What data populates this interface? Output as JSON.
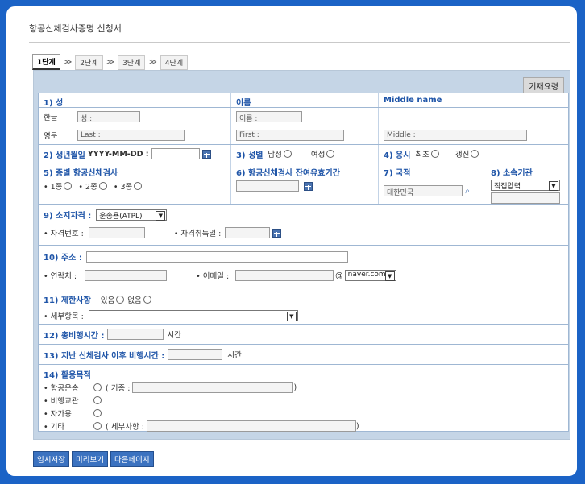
{
  "page": {
    "title": "항공신체검사증명 신청서"
  },
  "steps": [
    "1단계",
    "2단계",
    "3단계",
    "4단계"
  ],
  "step_sep": "≫",
  "remark_button": "기재요령",
  "name": {
    "surname_label": "1) 성",
    "given_label": "이름",
    "middle_label": "Middle name",
    "korean_label": "한글",
    "english_label": "영문",
    "surname_prefix": "성 :",
    "given_prefix": "이름 :",
    "last_prefix": "Last :",
    "first_prefix": "First :",
    "middle_prefix": "Middle :"
  },
  "birth": {
    "label": "2) 생년월일",
    "format": "YYYY-MM-DD :"
  },
  "gender": {
    "label": "3) 성별",
    "male": "남성",
    "female": "여성"
  },
  "apply": {
    "label": "4) 응시",
    "first": "최초",
    "renew": "갱신"
  },
  "grade": {
    "label": "5) 종별 항공신체검사",
    "opt1": "• 1종",
    "opt2": "• 2종",
    "opt3": "• 3종"
  },
  "validity": {
    "label": "6) 항공신체검사 잔여유효기간"
  },
  "nation": {
    "label": "7) 국적",
    "value": "대한민국"
  },
  "org": {
    "label": "8) 소속기관",
    "select": "직접입력"
  },
  "license": {
    "label": "9) 소지자격 :",
    "select": "운송용(ATPL)",
    "number_label": "• 자격번호 :",
    "date_label": "• 자격취득일 :"
  },
  "address": {
    "label": "10) 주소 :",
    "phone_label": "• 연락처 :",
    "email_label": "• 이메일 :",
    "at": "@",
    "domain": "naver.com"
  },
  "restriction": {
    "label": "11) 제한사항",
    "yes": "있음",
    "no": "없음",
    "detail_label": "• 세부항목 :"
  },
  "total_hours": {
    "label": "12) 총비행시간 :",
    "unit": "시간"
  },
  "since_hours": {
    "label": "13) 지난 신체검사 이후 비행시간 :",
    "unit": "시간"
  },
  "purpose": {
    "label": "14) 활용목적",
    "items": [
      {
        "name": "• 항공운송",
        "extra_label": "( 기종 :",
        "close": ")"
      },
      {
        "name": "• 비행교관"
      },
      {
        "name": "• 자가용"
      },
      {
        "name": "• 기타",
        "extra_label": "( 세부사항 :",
        "close": ")"
      }
    ]
  },
  "bottom_buttons": [
    "임시저장",
    "미리보기",
    "다음페이지"
  ]
}
